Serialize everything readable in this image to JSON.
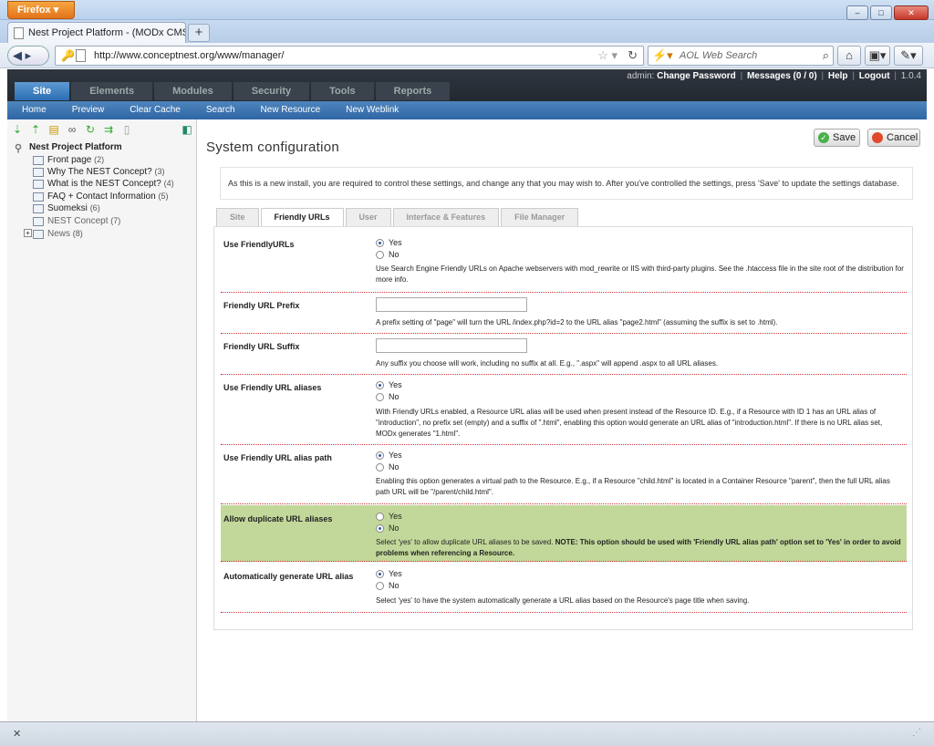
{
  "browser": {
    "app_button": "Firefox ▾",
    "tab_title": "Nest Project Platform - (MODx CMS Ma...",
    "url": "http://www.conceptnest.org/www/manager/",
    "search_placeholder": "AOL Web Search"
  },
  "header": {
    "user": "admin:",
    "change_password": "Change Password",
    "messages": "Messages (0 / 0)",
    "help": "Help",
    "logout": "Logout",
    "version": "1.0.4"
  },
  "mainnav": [
    "Site",
    "Elements",
    "Modules",
    "Security",
    "Tools",
    "Reports"
  ],
  "subnav": [
    "Home",
    "Preview",
    "Clear Cache",
    "Search",
    "New Resource",
    "New Weblink"
  ],
  "tree": {
    "root": "Nest Project Platform",
    "items": [
      {
        "label": "Front page",
        "count": "(2)"
      },
      {
        "label": "Why The NEST Concept?",
        "count": "(3)"
      },
      {
        "label": "What is the NEST Concept?",
        "count": "(4)"
      },
      {
        "label": "FAQ + Contact Information",
        "count": "(5)"
      },
      {
        "label": "Suomeksi",
        "count": "(6)"
      },
      {
        "label": "NEST Concept",
        "count": "(7)"
      },
      {
        "label": "News",
        "count": "(8)"
      }
    ]
  },
  "page": {
    "title": "System configuration",
    "save": "Save",
    "cancel": "Cancel",
    "notice": "As this is a new install, you are required to control these settings, and change any that you may wish to. After you've controlled the settings, press 'Save' to update the settings database.",
    "tabs": [
      "Site",
      "Friendly URLs",
      "User",
      "Interface & Features",
      "File Manager"
    ]
  },
  "settings": {
    "yes": "Yes",
    "no": "No",
    "friendly_urls": {
      "label": "Use FriendlyURLs",
      "desc": "Use Search Engine Friendly URLs on Apache webservers with mod_rewrite or IIS with third-party plugins. See the .htaccess file in the site root of the distribution for more info."
    },
    "prefix": {
      "label": "Friendly URL Prefix",
      "value": "",
      "desc": "A prefix setting of \"page\" will turn the URL /index.php?id=2 to the URL alias \"page2.html\" (assuming the suffix is set to .html)."
    },
    "suffix": {
      "label": "Friendly URL Suffix",
      "value": "",
      "desc": "Any suffix you choose will work, including no suffix at all. E.g., \".aspx\" will append .aspx to all URL aliases."
    },
    "aliases": {
      "label": "Use Friendly URL aliases",
      "desc": "With Friendly URLs enabled, a Resource URL alias will be used when present instead of the Resource ID. E.g., if a Resource with ID 1 has an URL alias of \"introduction\", no prefix set (empty) and a suffix of \".html\", enabling this option would generate an URL alias of \"introduction.html\". If there is no URL alias set, MODx generates \"1.html\"."
    },
    "alias_path": {
      "label": "Use Friendly URL alias path",
      "desc": "Enabling this option generates a virtual path to the Resource. E.g., if a Resource \"child.html\" is located in a Container Resource \"parent\", then the full URL alias path URL will be \"/parent/child.html\"."
    },
    "duplicate": {
      "label": "Allow duplicate URL aliases",
      "desc_plain": "Select 'yes' to allow duplicate URL aliases to be saved. ",
      "desc_bold": "NOTE: This option should be used with 'Friendly URL alias path' option set to 'Yes' in order to avoid problems when referencing a Resource."
    },
    "auto_alias": {
      "label": "Automatically generate URL alias",
      "desc": "Select 'yes' to have the system automatically generate a URL alias based on the Resource's page title when saving."
    }
  }
}
